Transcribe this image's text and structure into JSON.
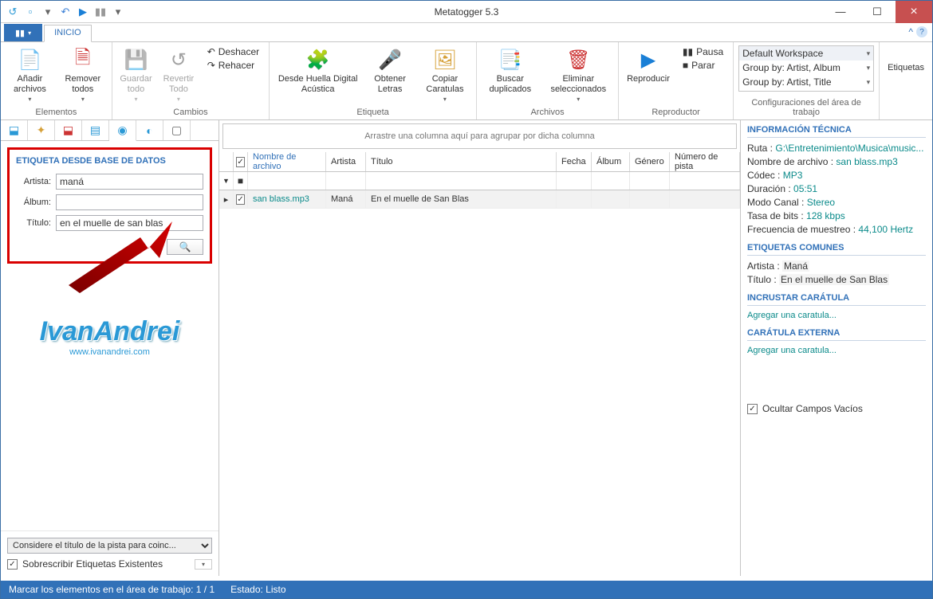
{
  "window": {
    "title": "Metatogger 5.3"
  },
  "tabs": {
    "main": "INICIO"
  },
  "ribbon": {
    "elementos": {
      "label": "Elementos",
      "add": "Añadir\narchivos",
      "remove": "Remover\ntodos"
    },
    "cambios": {
      "label": "Cambios",
      "save": "Guardar\ntodo",
      "revert": "Revertir\nTodo",
      "undo": "Deshacer",
      "redo": "Rehacer"
    },
    "etiqueta": {
      "label": "Etiqueta",
      "acoustic": "Desde Huella Digital\nAcústica",
      "lyrics": "Obtener\nLetras",
      "covers": "Copiar\nCaratulas"
    },
    "archivos": {
      "label": "Archivos",
      "dup": "Buscar\nduplicados",
      "elim": "Eliminar\nseleccionados"
    },
    "reproductor": {
      "label": "Reproductor",
      "play": "Reproducir",
      "pause": "Pausa",
      "stop": "Parar"
    },
    "workspace": {
      "label": "Configuraciones del área de trabajo",
      "items": [
        "Default Workspace",
        "Group by: Artist, Album",
        "Group by: Artist, Title"
      ]
    },
    "tags": {
      "label": "Etiquetas"
    }
  },
  "panel": {
    "header": "ETIQUETA DESDE BASE DE DATOS",
    "artist_label": "Artista:",
    "artist_value": "maná",
    "album_label": "Álbum:",
    "album_value": "",
    "title_label": "Título:",
    "title_value": "en el muelle de san blas"
  },
  "leftbottom": {
    "select": "Considere el título de la pista para coinc...",
    "overwrite": "Sobrescribir Etiquetas Existentes"
  },
  "logo": {
    "text": "IvanAndrei",
    "url": "www.ivanandrei.com"
  },
  "grid": {
    "groupbar": "Arrastre una columna aquí para agrupar por dicha columna",
    "headers": [
      "Nombre de archivo",
      "Artista",
      "Título",
      "Fecha",
      "Álbum",
      "Género",
      "Número de pista"
    ],
    "row": {
      "file": "san blass.mp3",
      "artist": "Maná",
      "title": "En el muelle de San Blas"
    }
  },
  "info": {
    "tech_header": "INFORMACIÓN TÉCNICA",
    "ruta_k": "Ruta : ",
    "ruta_v": "G:\\Entretenimiento\\Musica\\music...",
    "file_k": "Nombre de archivo : ",
    "file_v": "san blass.mp3",
    "codec_k": "Códec : ",
    "codec_v": "MP3",
    "dur_k": "Duración : ",
    "dur_v": "05:51",
    "mode_k": "Modo Canal : ",
    "mode_v": "Stereo",
    "bitrate_k": "Tasa de bits : ",
    "bitrate_v": "128 kbps",
    "freq_k": "Frecuencia de muestreo : ",
    "freq_v": "44,100 Hertz",
    "common_header": "ETIQUETAS COMUNES",
    "artist_k": "Artista : ",
    "artist_v": "Maná",
    "title_k": "Título : ",
    "title_v": "En el muelle de San Blas",
    "embed_header": "INCRUSTAR CARÁTULA",
    "ext_header": "CARÁTULA EXTERNA",
    "add_cover": "Agregar una caratula...",
    "hide_empty": "Ocultar Campos Vacíos"
  },
  "status": {
    "mark": "Marcar los elementos en el área de trabajo:  1 / 1",
    "state": "Estado:  Listo"
  }
}
